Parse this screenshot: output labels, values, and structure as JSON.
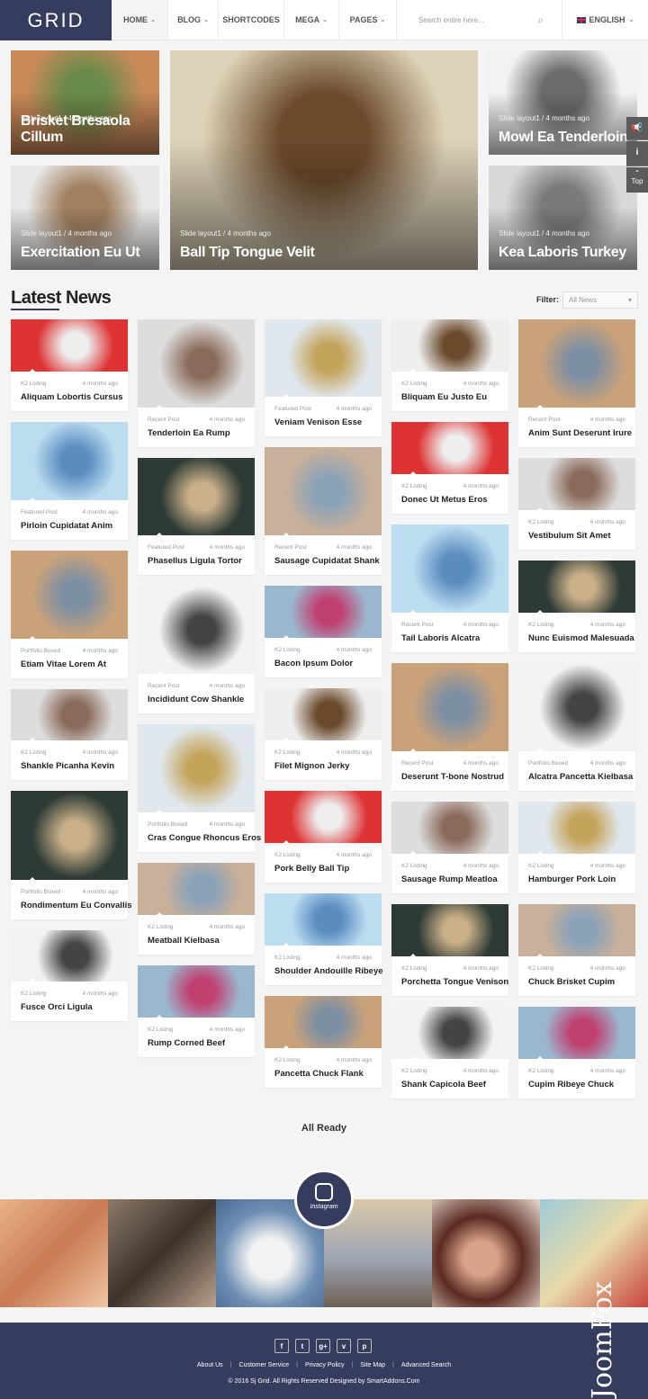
{
  "header": {
    "logo": "GRID",
    "nav": [
      {
        "label": "HOME",
        "dropdown": true
      },
      {
        "label": "BLOG",
        "dropdown": true
      },
      {
        "label": "SHORTCODES",
        "dropdown": false
      },
      {
        "label": "MEGA",
        "dropdown": true
      },
      {
        "label": "PAGES",
        "dropdown": true
      }
    ],
    "search_placeholder": "Search entire here...",
    "language": "ENGLISH"
  },
  "hero": [
    {
      "meta": "Slide layout1 / 4 months ago",
      "title": "Brisket Bresaola Cillum"
    },
    {
      "meta": "Slide layout1 / 4 months ago",
      "title": "Exercitation Eu Ut"
    },
    {
      "meta": "Slide layout1 / 4 months ago",
      "title": "Ball Tip Tongue Velit"
    },
    {
      "meta": "Slide layout1 / 4 months ago",
      "title": "Mowl Ea Tenderloin"
    },
    {
      "meta": "Slide layout1 / 4 months ago",
      "title": "Kea Laboris Turkey"
    }
  ],
  "side_tools": {
    "top_label": "Top"
  },
  "latest": {
    "title": "Latest News",
    "filter_label": "Filter:",
    "filter_value": "All News"
  },
  "columns": [
    [
      {
        "c": "K2 Listing",
        "d": "4 months ago",
        "t": "Aliquam Lobortis Cursus"
      },
      {
        "c": "Featured Post",
        "d": "4 months ago",
        "t": "Pirloin Cupidatat Anim"
      },
      {
        "c": "Portfolio Boxed",
        "d": "4 months ago",
        "t": "Etiam Vitae Lorem At"
      },
      {
        "c": "K2 Listing",
        "d": "4 months ago",
        "t": "Shankle Picanha Kevin"
      },
      {
        "c": "Portfolio Boxed",
        "d": "4 months ago",
        "t": "Rondimentum Eu Convallis"
      },
      {
        "c": "K2 Listing",
        "d": "4 months ago",
        "t": "Fusce Orci Ligula"
      }
    ],
    [
      {
        "c": "Recent Post",
        "d": "4 months ago",
        "t": "Tenderloin Ea Rump"
      },
      {
        "c": "Featured Post",
        "d": "4 months ago",
        "t": "Phasellus Ligula Tortor"
      },
      {
        "c": "Recent Post",
        "d": "4 months ago",
        "t": "Incididunt Cow Shankle"
      },
      {
        "c": "Portfolio Boxed",
        "d": "4 months ago",
        "t": "Cras Congue Rhoncus Eros"
      },
      {
        "c": "K2 Listing",
        "d": "4 months ago",
        "t": "Meatball Kielbasa"
      },
      {
        "c": "K2 Listing",
        "d": "4 months ago",
        "t": "Rump Corned Beef"
      }
    ],
    [
      {
        "c": "Featured Post",
        "d": "4 months ago",
        "t": "Veniam Venison Esse"
      },
      {
        "c": "Recent Post",
        "d": "4 months ago",
        "t": "Sausage Cupidatat Shank"
      },
      {
        "c": "K2 Listing",
        "d": "4 months ago",
        "t": "Bacon Ipsum Dolor"
      },
      {
        "c": "K2 Listing",
        "d": "4 months ago",
        "t": "Filet Mignon Jerky"
      },
      {
        "c": "K2 Listing",
        "d": "4 months ago",
        "t": "Pork Belly Ball Tip"
      },
      {
        "c": "K2 Listing",
        "d": "4 months ago",
        "t": "Shoulder Andouille Ribeye"
      },
      {
        "c": "K2 Listing",
        "d": "4 months ago",
        "t": "Pancetta Chuck Flank"
      }
    ],
    [
      {
        "c": "K2 Listing",
        "d": "4 months ago",
        "t": "Bliquam Eu Justo Eu"
      },
      {
        "c": "K2 Listing",
        "d": "4 months ago",
        "t": "Donec Ut Metus Eros"
      },
      {
        "c": "Recent Post",
        "d": "4 months ago",
        "t": "Tail Laboris Alcatra"
      },
      {
        "c": "Recent Post",
        "d": "4 months ago",
        "t": "Deserunt T-bone Nostrud"
      },
      {
        "c": "K2 Listing",
        "d": "4 months ago",
        "t": "Sausage Rump Meatloa"
      },
      {
        "c": "K2 Listing",
        "d": "4 months ago",
        "t": "Porchetta Tongue Venison"
      },
      {
        "c": "K2 Listing",
        "d": "4 months ago",
        "t": "Shank Capicola Beef"
      }
    ],
    [
      {
        "c": "Recent Post",
        "d": "4 months ago",
        "t": "Anim Sunt Deserunt Irure"
      },
      {
        "c": "K2 Listing",
        "d": "4 months ago",
        "t": "Vestibulum Sit Amet"
      },
      {
        "c": "K2 Listing",
        "d": "4 months ago",
        "t": "Nunc Euismod Malesuada"
      },
      {
        "c": "Portfolio Boxed",
        "d": "4 months ago",
        "t": "Alcatra Pancetta Kielbasa"
      },
      {
        "c": "K2 Listing",
        "d": "4 months ago",
        "t": "Hamburger Pork Loin"
      },
      {
        "c": "K2 Listing",
        "d": "4 months ago",
        "t": "Chuck Brisket Cupim"
      },
      {
        "c": "K2 Listing",
        "d": "4 months ago",
        "t": "Cupim Ribeye Chuck"
      }
    ]
  ],
  "status": "All Ready",
  "instagram": {
    "label": "Instagram"
  },
  "footer": {
    "social": [
      "f",
      "t",
      "g+",
      "v",
      "p"
    ],
    "links": [
      "About Us",
      "Customer Service",
      "Privacy Policy",
      "Site Map",
      "Advanced Search"
    ],
    "copyright": "© 2016 Sj Grid. All Rights Reserved Designed by SmartAddons.Com",
    "brand_logo": "JoomFox CREATIVE WEB STUDIO"
  },
  "colors": {
    "brand": "#353c5e",
    "background": "#f4f4f4"
  }
}
